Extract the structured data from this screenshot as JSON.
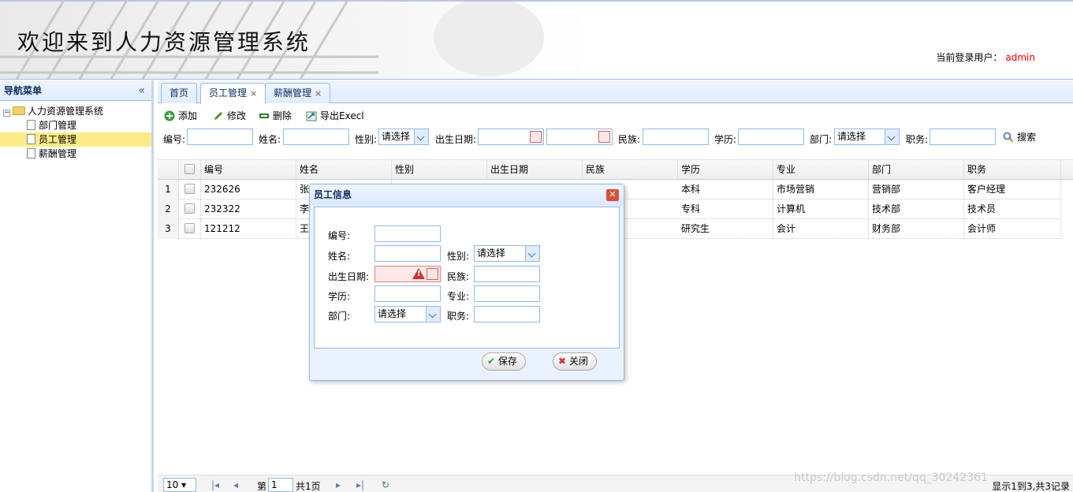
{
  "header": {
    "title": "欢迎来到人力资源管理系统",
    "user_label": "当前登录用户：",
    "user_name": "admin"
  },
  "nav": {
    "title": "导航菜单",
    "collapse": "«",
    "root": "人力资源管理系统",
    "items": [
      {
        "label": "部门管理"
      },
      {
        "label": "员工管理"
      },
      {
        "label": "薪酬管理"
      }
    ]
  },
  "tabs": [
    {
      "label": "首页"
    },
    {
      "label": "员工管理",
      "close": "×"
    },
    {
      "label": "薪酬管理",
      "close": "×"
    }
  ],
  "toolbar": {
    "add": "添加",
    "edit": "修改",
    "delete": "删除",
    "export": "导出Execl"
  },
  "search": {
    "id_label": "编号:",
    "name_label": "姓名:",
    "gender_label": "性别:",
    "gender_value": "请选择",
    "birth_label": "出生日期:",
    "nation_label": "民族:",
    "edu_label": "学历:",
    "dept_label": "部门:",
    "dept_value": "请选择",
    "job_label": "职务:",
    "search_btn": "搜索"
  },
  "grid": {
    "columns": [
      "编号",
      "姓名",
      "性别",
      "出生日期",
      "民族",
      "学历",
      "专业",
      "部门",
      "职务"
    ],
    "rows": [
      {
        "n": "1",
        "id": "232626",
        "name": "张",
        "edu": "本科",
        "major": "市场营销",
        "dept": "营销部",
        "job": "客户经理"
      },
      {
        "n": "2",
        "id": "232322",
        "name": "李",
        "edu": "专科",
        "major": "计算机",
        "dept": "技术部",
        "job": "技术员"
      },
      {
        "n": "3",
        "id": "121212",
        "name": "王",
        "edu": "研究生",
        "major": "会计",
        "dept": "财务部",
        "job": "会计师"
      }
    ]
  },
  "pager": {
    "page_size": "10",
    "page_prefix": "第",
    "page_value": "1",
    "page_suffix": "共1页",
    "summary": "显示1到3,共3记录"
  },
  "watermark": "https://blog.csdn.net/qq_30242361",
  "dialog": {
    "title": "员工信息",
    "id_label": "编号:",
    "name_label": "姓名:",
    "gender_label": "性别:",
    "gender_value": "请选择",
    "birth_label": "出生日期:",
    "nation_label": "民族:",
    "edu_label": "学历:",
    "major_label": "专业:",
    "dept_label": "部门:",
    "dept_value": "请选择",
    "job_label": "职务:",
    "save": "保存",
    "close": "关闭"
  }
}
